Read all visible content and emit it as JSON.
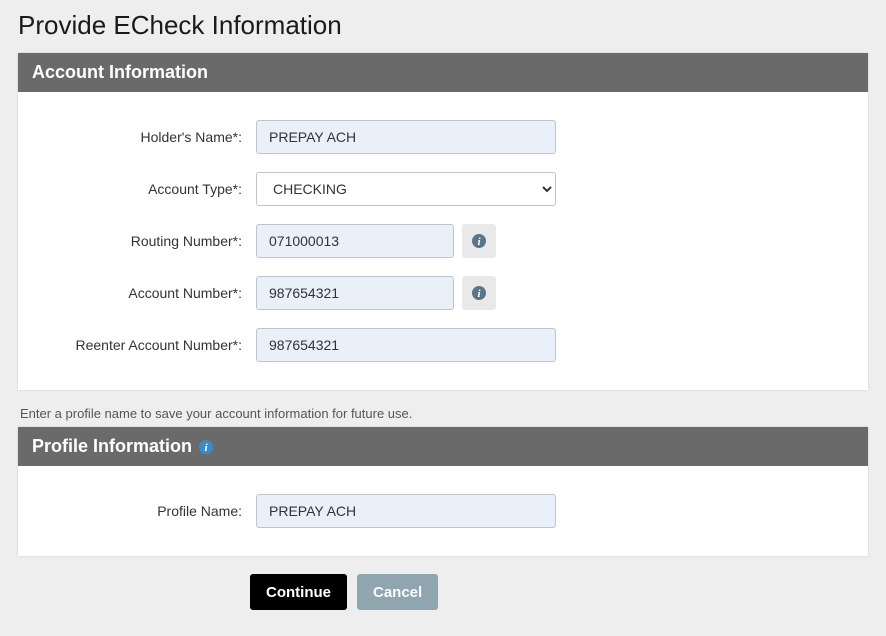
{
  "page": {
    "title": "Provide ECheck Information"
  },
  "account": {
    "header": "Account Information",
    "labels": {
      "holder": "Holder's Name*:",
      "type": "Account Type*:",
      "routing": "Routing Number*:",
      "account": "Account Number*:",
      "reenter": "Reenter Account Number*:"
    },
    "values": {
      "holder": "PREPAY ACH",
      "type": "CHECKING",
      "routing": "071000013",
      "account": "987654321",
      "reenter": "987654321"
    }
  },
  "profile": {
    "helper": "Enter a profile name to save your account information for future use.",
    "header": "Profile Information",
    "labels": {
      "name": "Profile Name:"
    },
    "values": {
      "name": "PREPAY ACH"
    }
  },
  "buttons": {
    "continue": "Continue",
    "cancel": "Cancel"
  }
}
